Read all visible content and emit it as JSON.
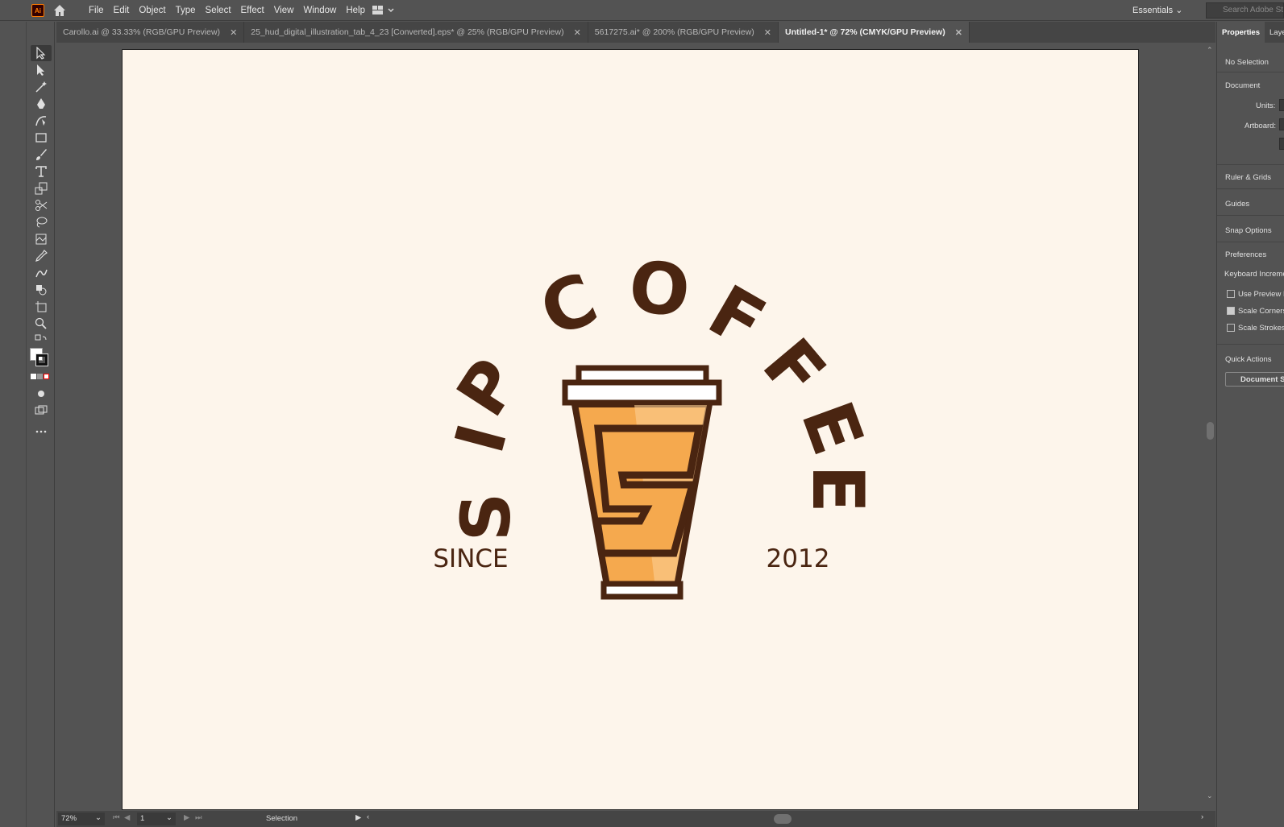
{
  "app": {
    "logo_text": "Ai"
  },
  "menu": [
    "File",
    "Edit",
    "Object",
    "Type",
    "Select",
    "Effect",
    "View",
    "Window",
    "Help"
  ],
  "workspace": {
    "label": "Essentials"
  },
  "search": {
    "placeholder": "Search Adobe St"
  },
  "tabs": [
    {
      "label": "Carollo.ai @ 33.33% (RGB/GPU Preview)",
      "active": false
    },
    {
      "label": "25_hud_digital_illustration_tab_4_23 [Converted].eps* @ 25% (RGB/GPU Preview)",
      "active": false
    },
    {
      "label": "5617275.ai* @ 200% (RGB/GPU Preview)",
      "active": false
    },
    {
      "label": "Untitled-1* @ 72% (CMYK/GPU Preview)",
      "active": true
    }
  ],
  "artwork": {
    "arc_text_left": "SIP",
    "arc_text_right": "COFFEE",
    "since_label": "SINCE",
    "year_label": "2012",
    "cup_letter": "S",
    "colors": {
      "brown": "#4a2511",
      "orange": "#f5a94e",
      "light_orange": "#fbcf93",
      "artboard": "#fdf5eb"
    }
  },
  "status": {
    "zoom": "72%",
    "page": "1",
    "tool": "Selection"
  },
  "panel": {
    "tabs": [
      "Properties",
      "Layers"
    ],
    "no_selection": "No Selection",
    "document": "Document",
    "units_label": "Units:",
    "artboard_label": "Artboard:",
    "ruler_grids": "Ruler & Grids",
    "guides": "Guides",
    "snap_options": "Snap Options",
    "preferences": "Preferences",
    "keyboard_increment": "Keyboard Increment",
    "use_preview_bounds": "Use Preview Bounds",
    "scale_corners": "Scale Corners",
    "scale_strokes": "Scale Strokes & Effects",
    "quick_actions": "Quick Actions",
    "document_setup": "Document Setup",
    "scale_corners_checked": true
  },
  "tools": [
    "selection-tool",
    "direct-selection-tool",
    "magic-wand-tool",
    "pen-tool",
    "curvature-tool",
    "rectangle-tool",
    "paintbrush-tool",
    "type-tool",
    "scale-tool",
    "scissors-tool",
    "lasso-tool",
    "symbol-tool",
    "eyedropper-tool",
    "blend-tool",
    "shape-builder-tool",
    "artboard-tool",
    "zoom-tool"
  ]
}
